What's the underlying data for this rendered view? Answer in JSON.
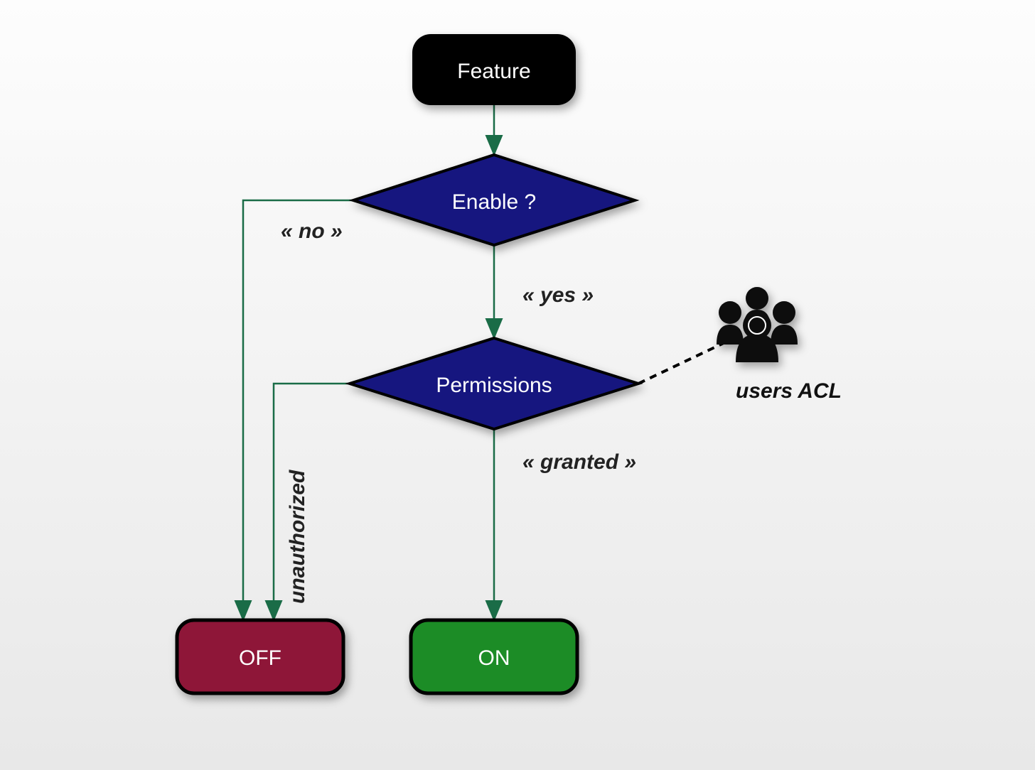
{
  "nodes": {
    "feature": "Feature",
    "enable": "Enable ?",
    "permissions": "Permissions",
    "off": "OFF",
    "on": "ON"
  },
  "edges": {
    "no": "« no »",
    "yes": "« yes »",
    "unauthorized": "unauthorized",
    "granted": "« granted »"
  },
  "labels": {
    "users_acl": "users ACL"
  },
  "colors": {
    "feature_bg": "#000000",
    "diamond_bg": "#15157f",
    "off_bg": "#8e1838",
    "on_bg": "#1e8c26",
    "arrow": "#1a6c47",
    "stroke": "#000000"
  }
}
